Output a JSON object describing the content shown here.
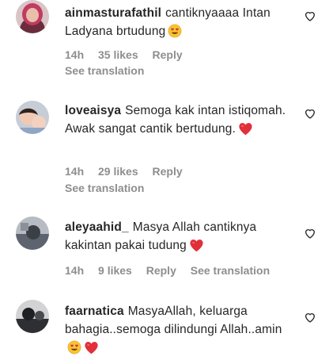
{
  "comments": [
    {
      "username": "ainmasturafathil",
      "text": "cantiknyaaaa Intan Ladyana brtudung",
      "emoji": [
        "smiling-face-heart-eyes-emoji"
      ],
      "time": "14h",
      "likes": "35 likes",
      "reply": "Reply",
      "translation": "See translation"
    },
    {
      "username": "loveaisya",
      "text": "Semoga kak intan istiqomah. Awak sangat cantik bertudung.",
      "emoji": [
        "red-heart-emoji"
      ],
      "time": "14h",
      "likes": "29 likes",
      "reply": "Reply",
      "translation": "See translation"
    },
    {
      "username": "aleyaahid_",
      "text": "Masya Allah cantiknya kakintan pakai tudung",
      "emoji": [
        "red-heart-emoji"
      ],
      "time": "14h",
      "likes": "9 likes",
      "reply": "Reply",
      "translation": "See translation"
    },
    {
      "username": "faarnatica",
      "text": "MasyaAllah, keluarga bahagia..semoga dilindungi Allah..amin",
      "emoji": [
        "smiling-face-heart-eyes-emoji",
        "red-heart-emoji"
      ]
    }
  ],
  "colors": {
    "text": "#262626",
    "secondary": "#8e8e8e",
    "heart": "#e0303a"
  },
  "icons": {
    "like": "heart-outline-icon"
  }
}
